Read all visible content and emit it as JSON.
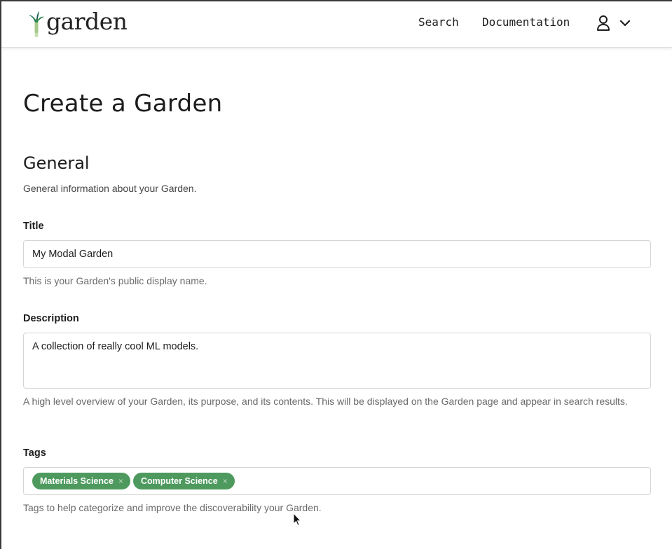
{
  "header": {
    "logo_text": "garden",
    "nav": {
      "search": "Search",
      "documentation": "Documentation"
    }
  },
  "page": {
    "title": "Create a Garden"
  },
  "general": {
    "heading": "General",
    "description": "General information about your Garden."
  },
  "form": {
    "title": {
      "label": "Title",
      "value": "My Modal Garden",
      "help": "This is your Garden's public display name."
    },
    "description": {
      "label": "Description",
      "value": "A collection of really cool ML models.",
      "help": "A high level overview of your Garden, its purpose, and its contents. This will be displayed on the Garden page and appear in search results."
    },
    "tags": {
      "label": "Tags",
      "items": [
        "Materials Science",
        "Computer Science"
      ],
      "remove_glyph": "×",
      "help": "Tags to help categorize and improve the discoverability your Garden."
    }
  },
  "colors": {
    "tag_background": "#4e9a5e",
    "logo_green": "#2f8a4a",
    "logo_dark": "#0f5a4a"
  },
  "icons": [
    "leek-logo-icon",
    "user-icon",
    "chevron-down-icon",
    "mouse-cursor-icon"
  ]
}
